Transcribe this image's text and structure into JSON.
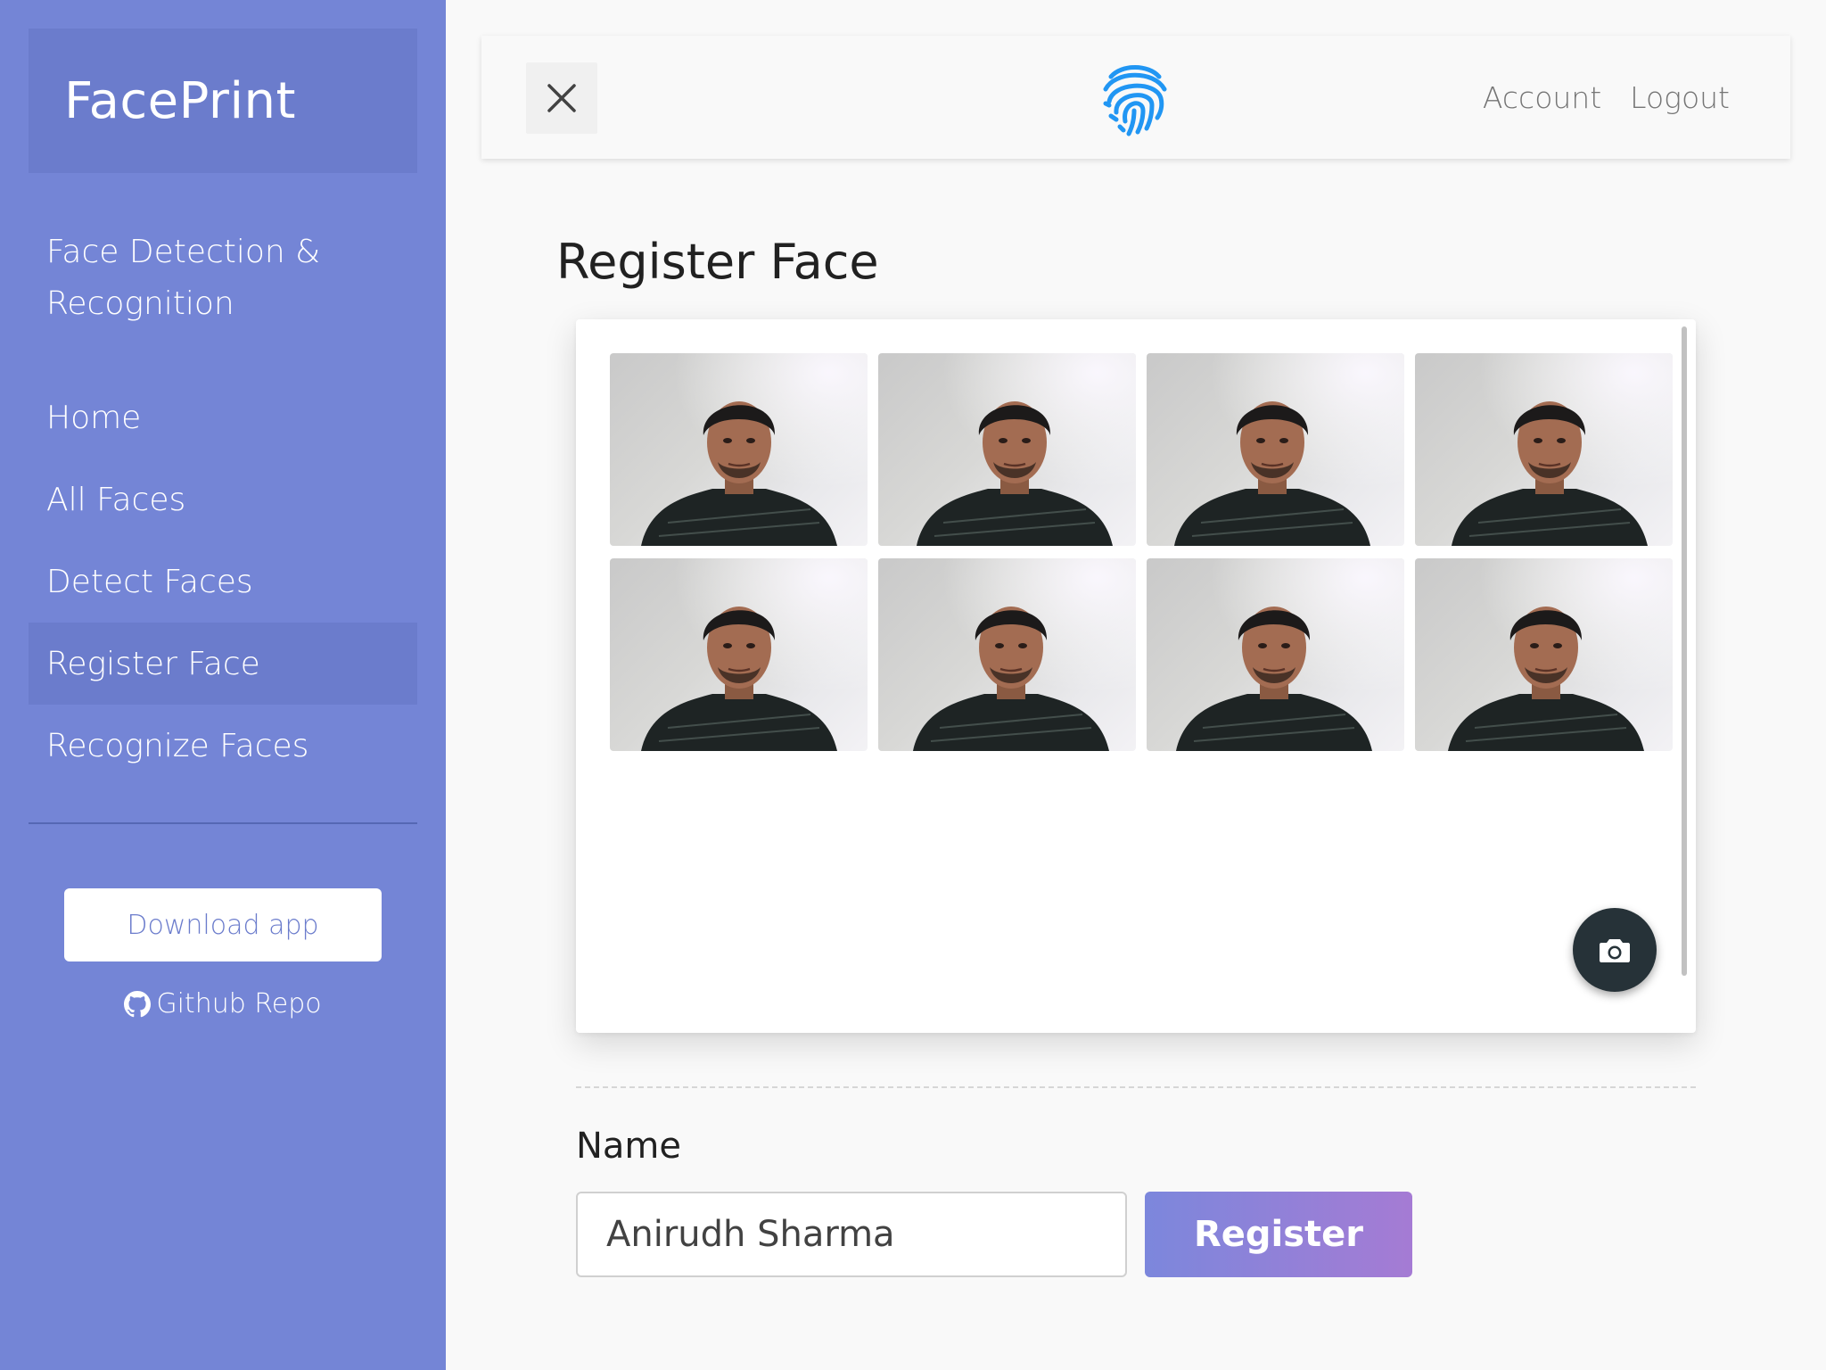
{
  "app": {
    "brand": "FacePrint",
    "subtitle": "Face Detection & Recognition"
  },
  "sidebar": {
    "items": [
      {
        "label": "Home",
        "active": false
      },
      {
        "label": "All Faces",
        "active": false
      },
      {
        "label": "Detect Faces",
        "active": false
      },
      {
        "label": "Register Face",
        "active": true
      },
      {
        "label": "Recognize Faces",
        "active": false
      }
    ],
    "download_label": "Download app",
    "github_label": "Github Repo"
  },
  "header": {
    "close_icon": "close-icon",
    "logo_icon": "fingerprint-icon",
    "links": [
      "Account",
      "Logout"
    ]
  },
  "main": {
    "title": "Register Face",
    "photos_count": 8,
    "camera_icon": "camera-icon",
    "name_label": "Name",
    "name_value": "Anirudh Sharma",
    "register_label": "Register"
  },
  "colors": {
    "sidebar": "#7485d6",
    "sidebar_active": "#6b7ccc",
    "fingerprint": "#2196f3",
    "register_gradient_start": "#7c87dc",
    "register_gradient_end": "#a57bd4",
    "fab": "#263238"
  }
}
